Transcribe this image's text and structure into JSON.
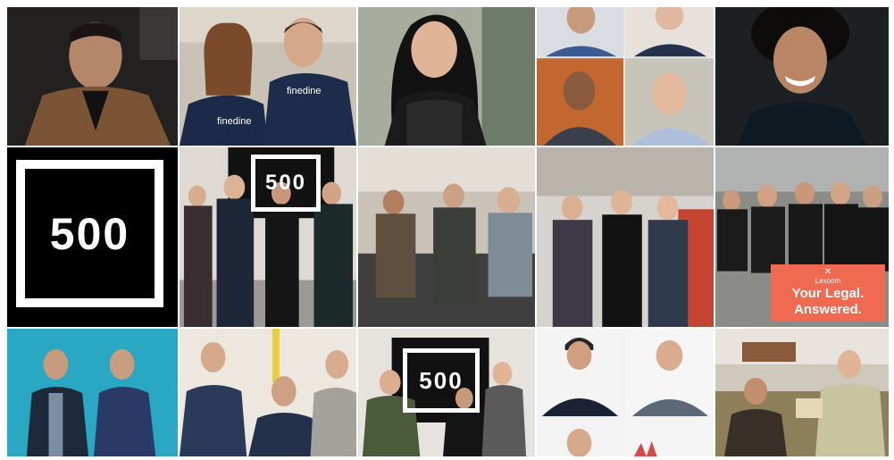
{
  "tiles": {
    "logo_main": "500",
    "logo_wall_1": "500",
    "logo_wall_2": "500",
    "shirt_brand": "finedine",
    "sign": {
      "brand": "Lexoom",
      "line1": "Your Legal.",
      "line2": "Answered."
    }
  },
  "colors": {
    "logo_bg": "#000000",
    "sign_bg": "#f06a52",
    "teal_wall": "#2aa7c2"
  }
}
